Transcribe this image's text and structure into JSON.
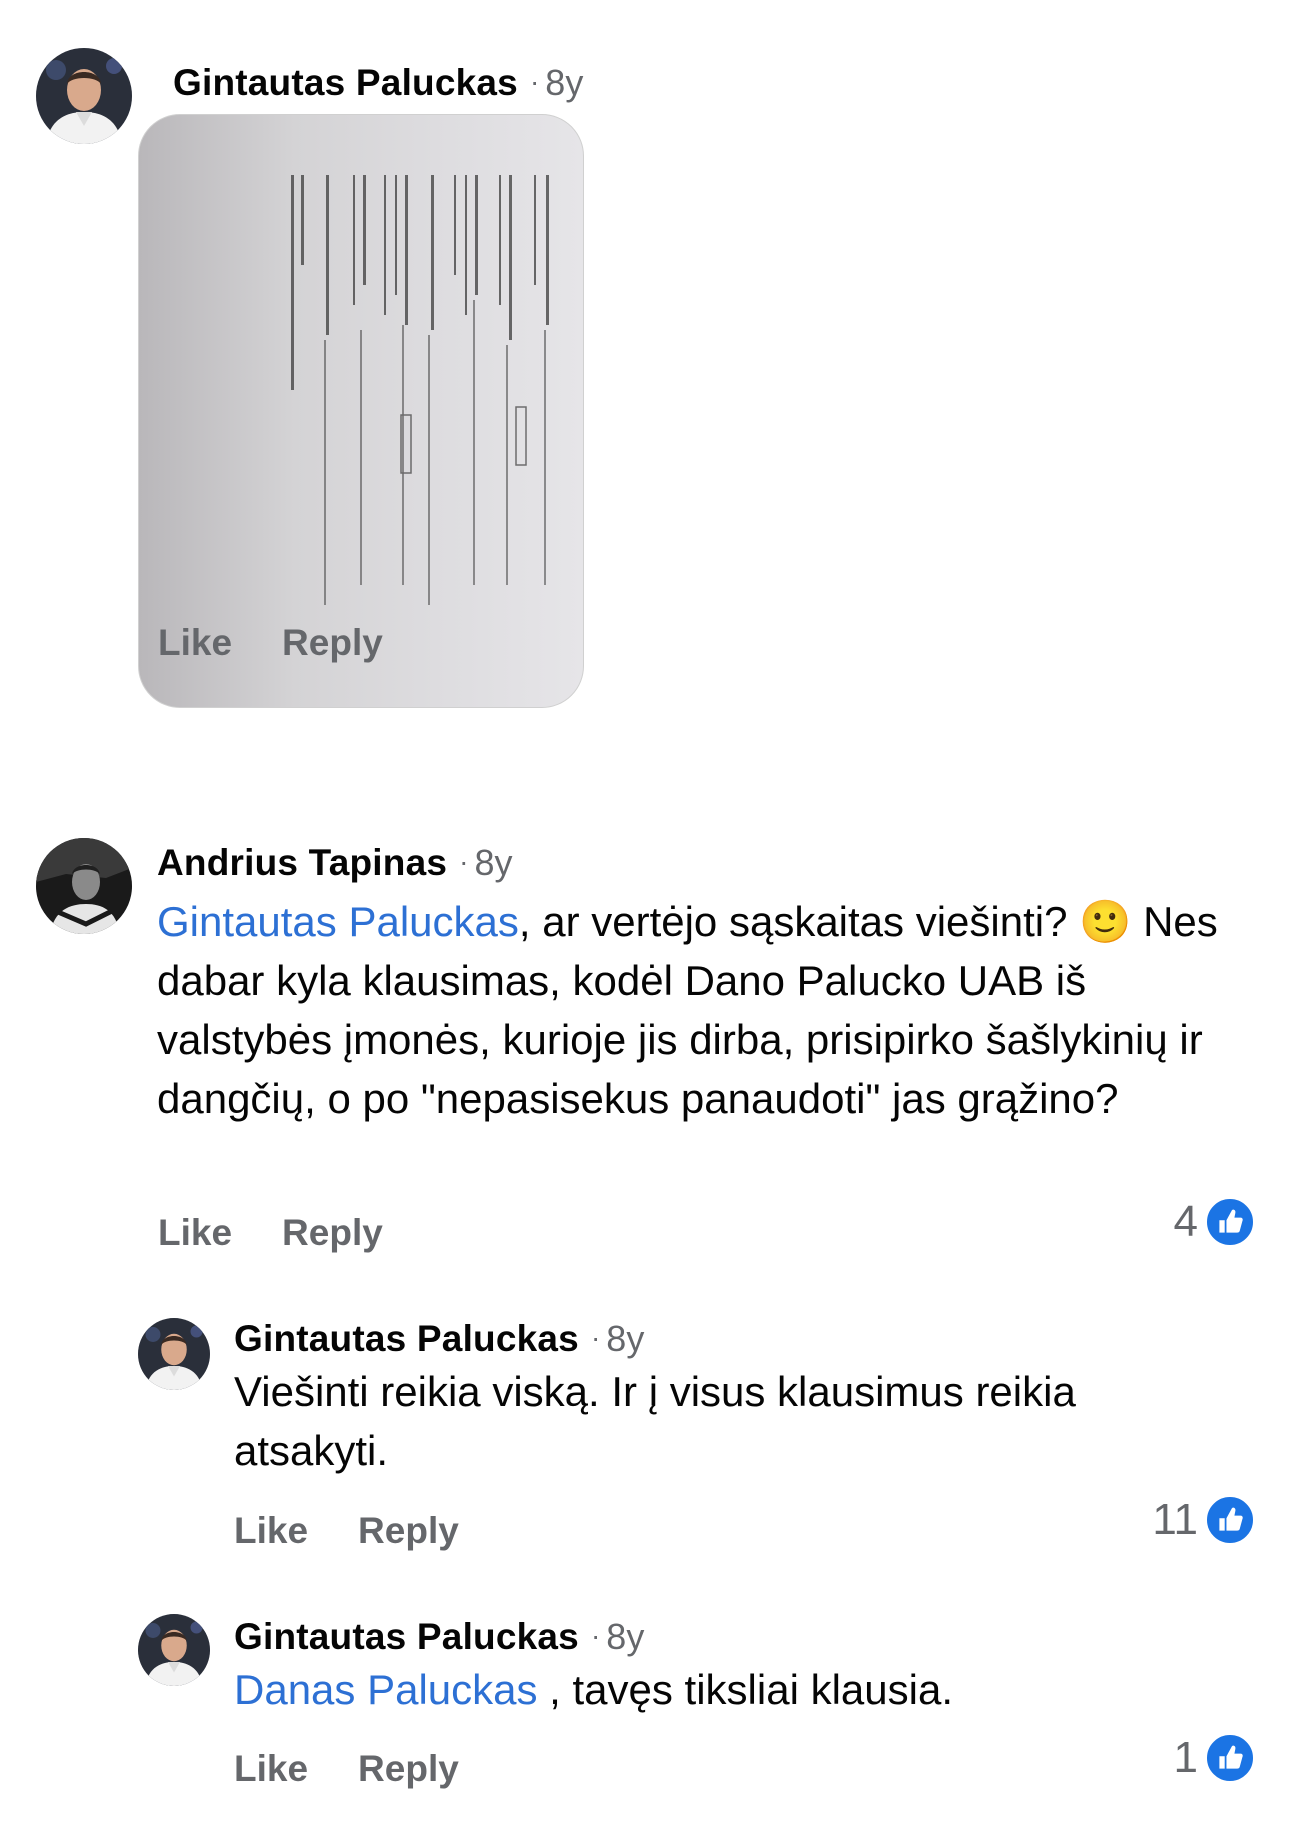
{
  "comments": [
    {
      "author": "Gintautas Paluckas",
      "time": "8y",
      "actions": {
        "like": "Like",
        "reply": "Reply"
      }
    },
    {
      "author": "Andrius Tapinas",
      "time": "8y",
      "mention": "Gintautas Paluckas",
      "text_after_mention": ", ar vertėjo sąskaitas viešinti? 🙂 Nes dabar kyla klausimas, kodėl Dano Palucko UAB iš valstybės įmonės, kurioje jis dirba, prisipirko šašlykinių ir dangčių, o po \"nepasisekus panaudoti\" jas grąžino?",
      "actions": {
        "like": "Like",
        "reply": "Reply"
      },
      "reactions": "4"
    },
    {
      "author": "Gintautas Paluckas",
      "time": "8y",
      "text": "Viešinti reikia viską. Ir į visus klausimus reikia atsakyti.",
      "actions": {
        "like": "Like",
        "reply": "Reply"
      },
      "reactions": "11"
    },
    {
      "author": "Gintautas Paluckas",
      "time": "8y",
      "mention": "Danas Paluckas",
      "text_after_mention": " , tavęs tiksliai klausia.",
      "actions": {
        "like": "Like",
        "reply": "Reply"
      },
      "reactions": "1"
    }
  ],
  "colors": {
    "mention": "#2d70d4",
    "meta": "#65676b",
    "like_badge": "#1b74e4"
  }
}
